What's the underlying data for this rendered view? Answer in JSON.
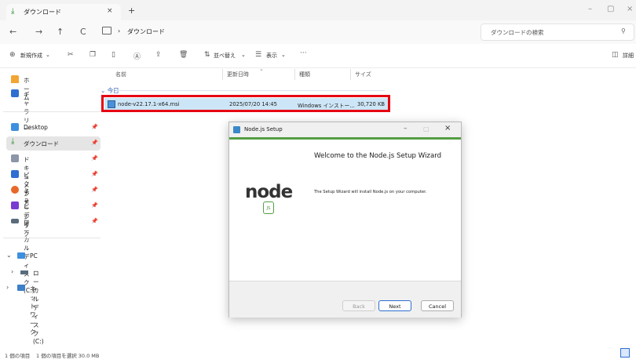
{
  "window": {
    "tab_title": "ダウンロード",
    "tab_close": "×",
    "new_tab": "+",
    "minimize": "–",
    "restore": "▢",
    "close": "×"
  },
  "nav": {
    "back": "←",
    "forward": "→",
    "up": "↑",
    "refresh": "C",
    "breadcrumb_sep": "›",
    "breadcrumb": "ダウンロード",
    "search_placeholder": "ダウンロードの検索"
  },
  "toolbar": {
    "new_label": "新規作成",
    "sort_label": "並べ替え",
    "view_label": "表示",
    "more": "···",
    "details_label": "詳細"
  },
  "sidebar": {
    "home": "ホーム",
    "gallery": "ギャラリー",
    "quick": [
      {
        "label": "Desktop"
      },
      {
        "label": "ダウンロード"
      },
      {
        "label": "ドキュメント"
      },
      {
        "label": "ピクチャ"
      },
      {
        "label": "ミュージック"
      },
      {
        "label": "ビデオ"
      },
      {
        "label": "ローカル ディスク (C:)"
      }
    ],
    "pc": "PC",
    "pc_disk": "ローカル ディスク (C:)",
    "network": "ネットワーク"
  },
  "filelist": {
    "columns": {
      "name": "名前",
      "date": "更新日時",
      "type": "種類",
      "size": "サイズ"
    },
    "group": "今日",
    "file": {
      "name": "node-v22.17.1-x64.msi",
      "date": "2025/07/20 14:45",
      "type": "Windows インストー...",
      "size": "30,720 KB"
    }
  },
  "status": {
    "items": "1 個の項目",
    "selected": "1 個の項目を選択 30.0 MB"
  },
  "dialog": {
    "title": "Node.js Setup",
    "minimize": "–",
    "maximize": "▢",
    "close": "×",
    "heading": "Welcome to the Node.js Setup Wizard",
    "body": "The Setup Wizard will install Node.js on your computer.",
    "logo_text": "node",
    "logo_badge": "JS",
    "back": "Back",
    "next": "Next",
    "cancel": "Cancel"
  },
  "colors": {
    "highlight_red": "#e60012",
    "selection_blue": "#cde6f7",
    "node_green": "#539e43"
  }
}
